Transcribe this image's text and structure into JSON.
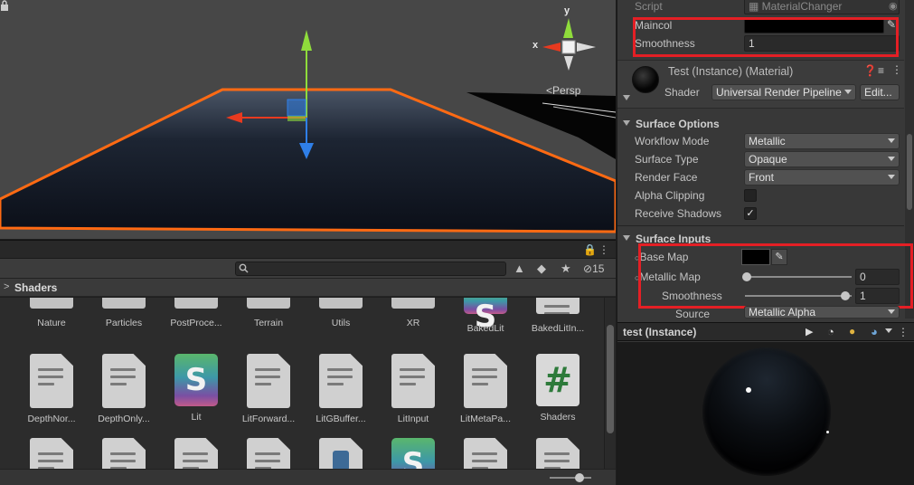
{
  "scene": {
    "persp_label": "Persp",
    "gizmo_axes": {
      "x": "x",
      "y": "y"
    }
  },
  "project": {
    "breadcrumb": "Shaders",
    "hidden_count": "15",
    "row1": [
      {
        "label": "Nature",
        "type": "folder"
      },
      {
        "label": "Particles",
        "type": "folder"
      },
      {
        "label": "PostProce...",
        "type": "folder"
      },
      {
        "label": "Terrain",
        "type": "folder"
      },
      {
        "label": "Utils",
        "type": "folder"
      },
      {
        "label": "XR",
        "type": "folder"
      },
      {
        "label": "BakedLit",
        "type": "shader"
      },
      {
        "label": "BakedLitIn...",
        "type": "doc"
      }
    ],
    "row2": [
      {
        "label": "DepthNor...",
        "type": "doc"
      },
      {
        "label": "DepthOnly...",
        "type": "doc"
      },
      {
        "label": "Lit",
        "type": "shader"
      },
      {
        "label": "LitForward...",
        "type": "doc"
      },
      {
        "label": "LitGBuffer...",
        "type": "doc"
      },
      {
        "label": "LitInput",
        "type": "doc"
      },
      {
        "label": "LitMetaPa...",
        "type": "doc"
      },
      {
        "label": "Shaders",
        "type": "hash"
      }
    ],
    "row3": [
      {
        "label": "",
        "type": "doc"
      },
      {
        "label": "",
        "type": "doc"
      },
      {
        "label": "",
        "type": "doc"
      },
      {
        "label": "",
        "type": "doc"
      },
      {
        "label": "",
        "type": "figure"
      },
      {
        "label": "",
        "type": "shader"
      },
      {
        "label": "",
        "type": "doc"
      },
      {
        "label": "",
        "type": "doc"
      }
    ]
  },
  "inspector": {
    "script_label": "Script",
    "script_value": "MaterialChanger",
    "maincol_label": "Maincol",
    "smoothness_label": "Smoothness",
    "smoothness_value": "1",
    "material_title": "Test (Instance) (Material)",
    "shader_label": "Shader",
    "shader_value": "Universal Render Pipeline",
    "edit_button": "Edit...",
    "surface_options": {
      "title": "Surface Options",
      "workflow_label": "Workflow Mode",
      "workflow_value": "Metallic",
      "surface_type_label": "Surface Type",
      "surface_type_value": "Opaque",
      "render_face_label": "Render Face",
      "render_face_value": "Front",
      "alpha_clipping_label": "Alpha Clipping",
      "alpha_clipping_checked": false,
      "receive_shadows_label": "Receive Shadows",
      "receive_shadows_checked": true
    },
    "surface_inputs": {
      "title": "Surface Inputs",
      "base_map_label": "Base Map",
      "metallic_map_label": "Metallic Map",
      "metallic_value": "0",
      "smoothness_label": "Smoothness",
      "smoothness_value": "1",
      "source_label": "Source",
      "source_value": "Metallic Alpha"
    },
    "preview_title": "test (Instance)"
  },
  "colors": {
    "highlight": "#e41f25",
    "selection_outline": "#ff6a13",
    "y_axis": "#8fdc3b",
    "x_axis": "#e83a1f",
    "z_axis": "#2f7fe8"
  }
}
